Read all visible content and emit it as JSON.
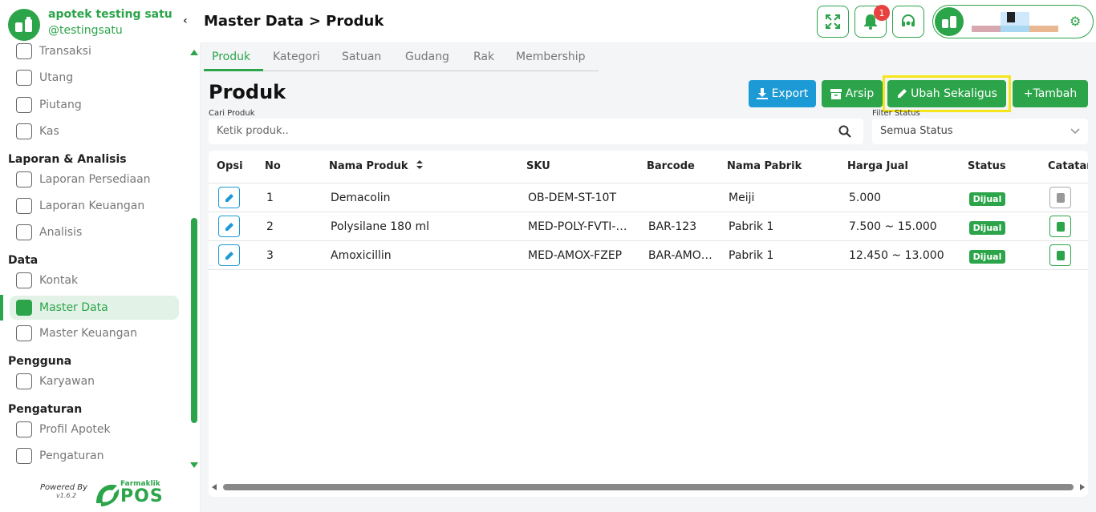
{
  "brand": {
    "name": "apotek testing satu",
    "username": "@testingsatu"
  },
  "sidebar": {
    "items": [
      {
        "label": "Transaksi",
        "icon": "exchange-icon"
      },
      {
        "label": "Utang",
        "icon": "receipt-icon"
      },
      {
        "label": "Piutang",
        "icon": "receipt-icon"
      },
      {
        "label": "Kas",
        "icon": "cash-icon"
      },
      {
        "label": "Laporan Persediaan",
        "icon": "clipboard-icon"
      },
      {
        "label": "Laporan Keuangan",
        "icon": "clipboard-icon"
      },
      {
        "label": "Analisis",
        "icon": "activity-icon"
      },
      {
        "label": "Kontak",
        "icon": "contact-book-icon"
      },
      {
        "label": "Master Data",
        "icon": "database-icon",
        "active": true
      },
      {
        "label": "Master Keuangan",
        "icon": "wallet-icon"
      },
      {
        "label": "Karyawan",
        "icon": "users-icon"
      },
      {
        "label": "Profil Apotek",
        "icon": "store-icon"
      },
      {
        "label": "Pengaturan",
        "icon": "gear-icon"
      }
    ],
    "sections": [
      "Laporan & Analisis",
      "Data",
      "Pengguna",
      "Pengaturan"
    ],
    "powered_by": "Powered By",
    "version": "v1.6.2",
    "logo_small": "Farmaklik",
    "logo_big": "POS"
  },
  "header": {
    "title": "Master Data > Produk",
    "notification_count": "1",
    "accent": "#2ca44a"
  },
  "tabs": [
    "Produk",
    "Kategori",
    "Satuan",
    "Gudang",
    "Rak",
    "Membership"
  ],
  "main": {
    "title": "Produk",
    "buttons": {
      "export": "Export",
      "arsip": "Arsip",
      "ubah": "Ubah Sekaligus",
      "tambah": "+Tambah"
    },
    "search": {
      "label": "Cari Produk",
      "placeholder": "Ketik produk.."
    },
    "filter": {
      "label": "Filter Status",
      "value": "Semua Status"
    }
  },
  "table": {
    "headers": [
      "Opsi",
      "No",
      "Nama Produk",
      "SKU",
      "Barcode",
      "Nama Pabrik",
      "Harga Jual",
      "Status",
      "Catatan"
    ],
    "rows": [
      {
        "no": "1",
        "name": "Demacolin",
        "sku": "OB-DEM-ST-10T",
        "barcode": "",
        "pabrik": "Meiji",
        "harga": "5.000",
        "status": "Dijual"
      },
      {
        "no": "2",
        "name": "Polysilane 180 ml",
        "sku": "MED-POLY-FVTI-…",
        "barcode": "BAR-123",
        "pabrik": "Pabrik 1",
        "harga": "7.500 ~ 15.000",
        "status": "Dijual"
      },
      {
        "no": "3",
        "name": "Amoxicillin",
        "sku": "MED-AMOX-FZEP",
        "barcode": "BAR-AMO…",
        "pabrik": "Pabrik 1",
        "harga": "12.450 ~ 13.000",
        "status": "Dijual"
      }
    ]
  }
}
